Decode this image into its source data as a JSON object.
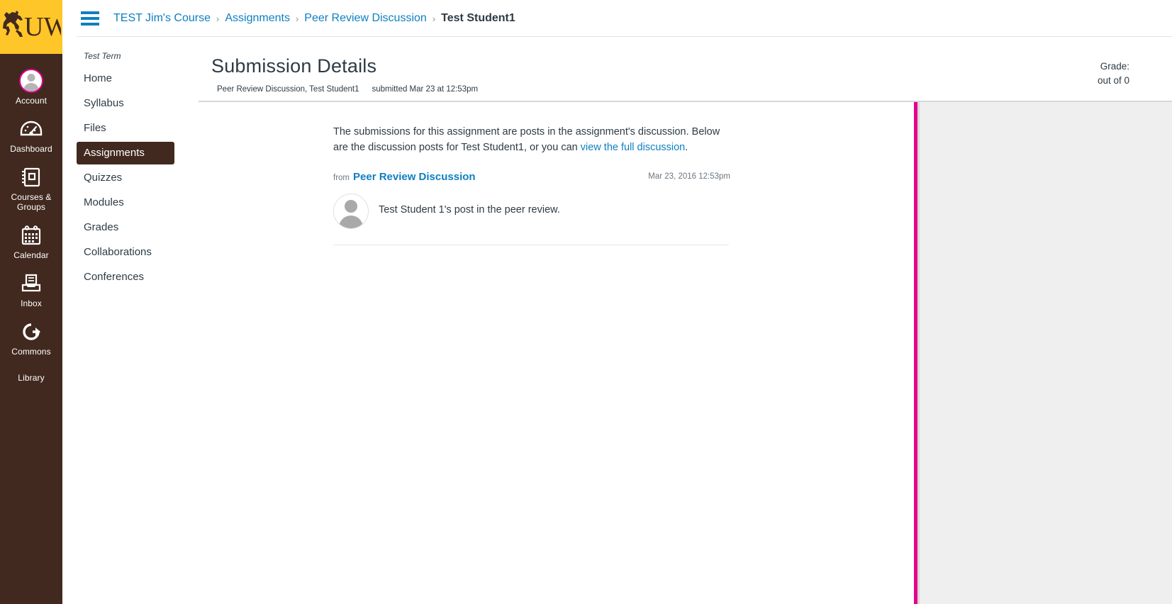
{
  "global_nav": {
    "brand": {
      "name": "university-of-wyoming-logo",
      "text": "UW"
    },
    "items": [
      {
        "label": "Account",
        "icon": "user-avatar-icon"
      },
      {
        "label": "Dashboard",
        "icon": "dashboard-gauge-icon"
      },
      {
        "label": "Courses & Groups",
        "icon": "courses-book-icon"
      },
      {
        "label": "Calendar",
        "icon": "calendar-icon"
      },
      {
        "label": "Inbox",
        "icon": "inbox-tray-icon"
      },
      {
        "label": "Commons",
        "icon": "commons-arrow-icon"
      },
      {
        "label": "Library",
        "icon": "none"
      }
    ]
  },
  "topbar": {
    "menu_icon": "hamburger-menu-icon",
    "breadcrumb": [
      {
        "label": "TEST Jim's Course",
        "current": false
      },
      {
        "label": "Assignments",
        "current": false
      },
      {
        "label": "Peer Review Discussion",
        "current": false
      },
      {
        "label": "Test Student1",
        "current": true
      }
    ],
    "separator": "›"
  },
  "course_nav": {
    "term": "Test Term",
    "items": [
      {
        "label": "Home",
        "active": false
      },
      {
        "label": "Syllabus",
        "active": false
      },
      {
        "label": "Files",
        "active": false
      },
      {
        "label": "Assignments",
        "active": true
      },
      {
        "label": "Quizzes",
        "active": false
      },
      {
        "label": "Modules",
        "active": false
      },
      {
        "label": "Grades",
        "active": false
      },
      {
        "label": "Collaborations",
        "active": false
      },
      {
        "label": "Conferences",
        "active": false
      }
    ]
  },
  "submission": {
    "title": "Submission Details",
    "context": "Peer Review Discussion, Test Student1",
    "submitted": "submitted Mar 23 at 12:53pm",
    "grade_label": "Grade:",
    "grade_out_of": "out of 0",
    "intro_part1": "The submissions for this assignment are posts in the assignment's discussion. Below are the discussion posts for Test Student1, or you can ",
    "intro_link": "view the full discussion",
    "intro_part2": ".",
    "entry": {
      "from_label": "from",
      "topic": "Peer Review Discussion",
      "date": "Mar 23, 2016 12:53pm",
      "avatar": "default-user-avatar",
      "text": "Test Student 1's post in the peer review."
    }
  },
  "colors": {
    "brand_gold": "#ffc629",
    "nav_brown": "#41291f",
    "link_blue": "#0e7fc1",
    "accent_magenta": "#e5008d",
    "rail_gray": "#efefef"
  }
}
